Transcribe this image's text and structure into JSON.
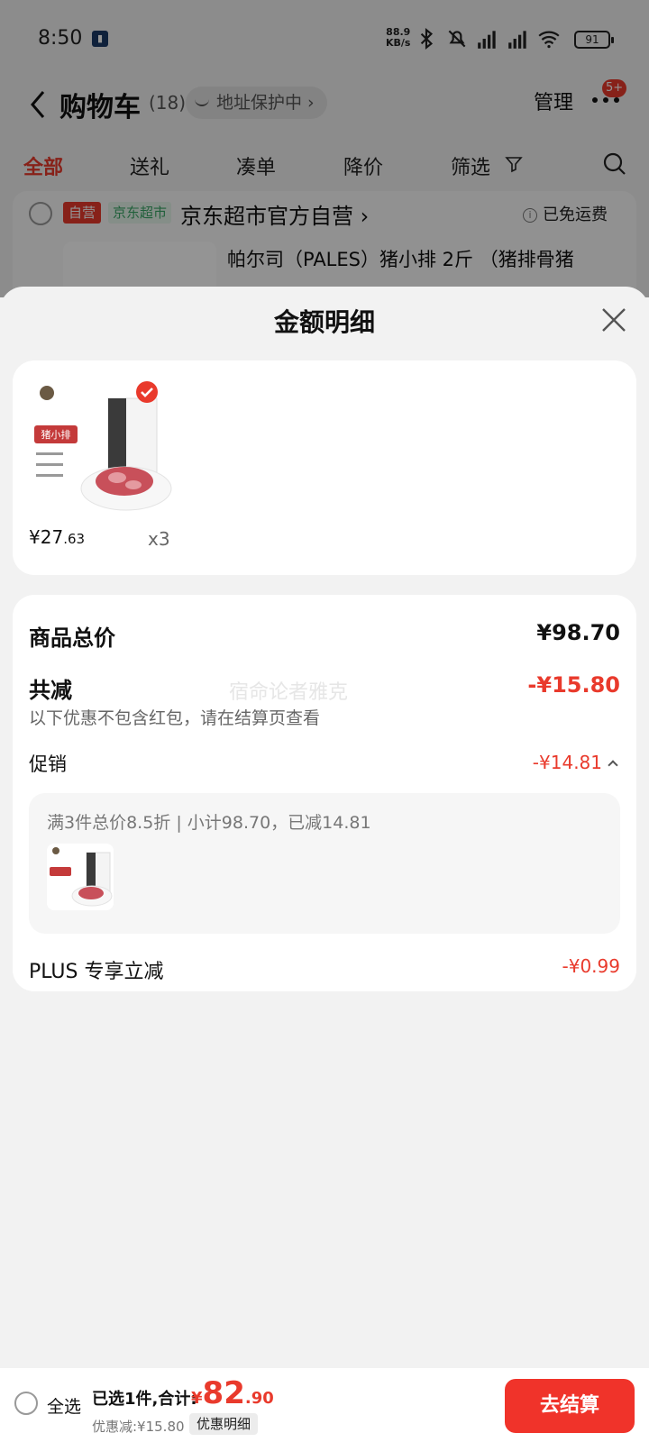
{
  "status": {
    "time": "8:50",
    "net_speed": "88.9",
    "net_unit": "KB/s",
    "battery": "91"
  },
  "header": {
    "title": "购物车",
    "count": "(18)",
    "address_pill": "地址保护中 ›",
    "manage": "管理",
    "badge": "5+"
  },
  "tabs": [
    {
      "label": "全部"
    },
    {
      "label": "送礼"
    },
    {
      "label": "凑单"
    },
    {
      "label": "降价"
    },
    {
      "label": "筛选"
    }
  ],
  "store": {
    "tag_self": "自营",
    "tag_jd": "京东超市",
    "name": "京东超市官方自营 ›",
    "shipping": "已免运费",
    "product_name": "帕尔司（PALES）猪小排 2斤 （猪排骨猪"
  },
  "sheet": {
    "title": "金额明细",
    "product": {
      "price_int": "¥27",
      "price_dec": ".63",
      "qty": "x3"
    },
    "total_label": "商品总价",
    "total_value": "¥98.70",
    "discount_label": "共减",
    "discount_value": "-¥15.80",
    "discount_note": "以下优惠不包含红包，请在结算页查看",
    "promo_label": "促销",
    "promo_value": "-¥14.81",
    "promo_box_text": "满3件总价8.5折 | 小计98.70，已减14.81",
    "plus_label": "PLUS 专享立减",
    "plus_value": "-¥0.99",
    "watermark": "宿命论者雅克"
  },
  "checkout": {
    "select_all": "全选",
    "selected_total_label": "已选1件,合计:",
    "price_symbol": "¥",
    "price_int": "82",
    "price_dec": ".90",
    "saved": "优惠减:¥15.80",
    "detail_button": "优惠明细",
    "checkout_button": "去结算"
  },
  "colors": {
    "accent_red": "#e93a2c",
    "checkout_red": "#f0332a",
    "jd_green": "#3aa566"
  }
}
